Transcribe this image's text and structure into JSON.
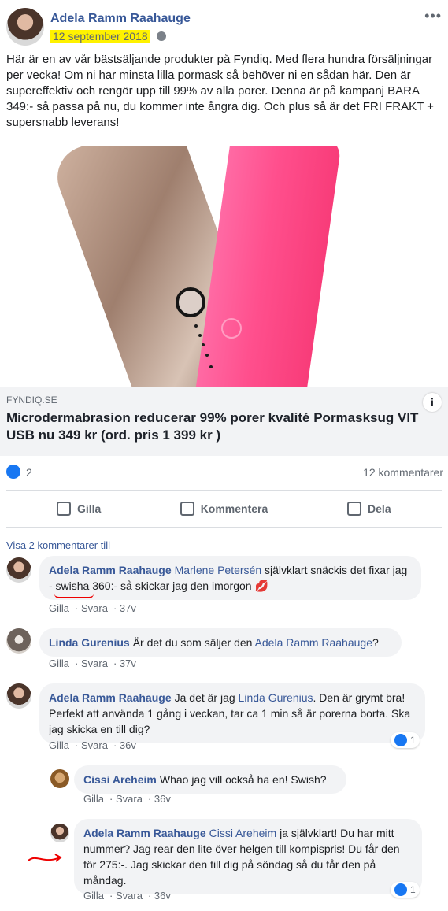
{
  "post": {
    "author": "Adela Ramm Raahauge",
    "date": "12 september 2018",
    "text": "Här är en av vår bästsäljande produkter på Fyndiq. Med flera hundra försäljningar per vecka! Om ni har minsta lilla pormask så behöver ni en sådan här. Den är supereffektiv och rengör upp till 99% av alla porer. Denna är på kampanj BARA 349:- så passa på nu, du kommer inte ångra dig. Och plus så är det FRI FRAKT + supersnabb leverans!",
    "link": {
      "domain": "FYNDIQ.SE",
      "title": "Microdermabrasion reducerar 99% porer kvalité Pormasksug VIT USB nu 349 kr (ord. pris 1 399 kr )",
      "info_icon": "i"
    },
    "reactions": {
      "count": "2",
      "comments": "12 kommentarer"
    },
    "actions": [
      {
        "label": "Gilla",
        "icon": "thumbs-up-icon"
      },
      {
        "label": "Kommentera",
        "icon": "comment-icon"
      },
      {
        "label": "Dela",
        "icon": "share-icon"
      }
    ]
  },
  "comments": {
    "view_more": "Visa 2 kommentarer till",
    "items": [
      {
        "author": "Adela Ramm Raahauge",
        "mention": "Marlene Petersén",
        "text": " självklart snäckis det fixar jag - swisha 360:- så skickar jag den imorgon ",
        "emoji": "💋",
        "like": "Gilla",
        "reply": "Svara",
        "time": "37v"
      },
      {
        "author": "Linda Gurenius",
        "text": "Är det du som säljer den ",
        "mention": "Adela Ramm Raahauge",
        "end": "?",
        "like": "Gilla",
        "reply": "Svara",
        "time": "37v"
      },
      {
        "author": "Adela Ramm Raahauge",
        "text": "Ja det är jag ",
        "mention": "Linda Gurenius",
        "rest": ". Den är grymt bra! Perfekt att använda 1 gång i veckan, tar ca 1 min så är porerna borta. Ska jag skicka en till dig?",
        "like": "Gilla",
        "reply": "Svara",
        "time": "36v",
        "like_count": "1"
      },
      {
        "author": "Cissi Areheim",
        "text": "Whao jag vill också ha en! Swish?",
        "like": "Gilla",
        "reply": "Svara",
        "time": "36v"
      },
      {
        "author": "Adela Ramm Raahauge",
        "mention": "Cissi Areheim",
        "text": " ja självklart! Du har mitt nummer? Jag rear den lite över helgen till kompispris! Du får den för 275:-. Jag skickar den till dig på söndag så du får den på måndag.",
        "like": "Gilla",
        "reply": "Svara",
        "time": "36v",
        "like_count": "1"
      }
    ]
  },
  "colors": {
    "link": "#385898",
    "highlight": "#fff200",
    "like_blue": "#1877f2",
    "annotation_red": "#ee0000"
  }
}
